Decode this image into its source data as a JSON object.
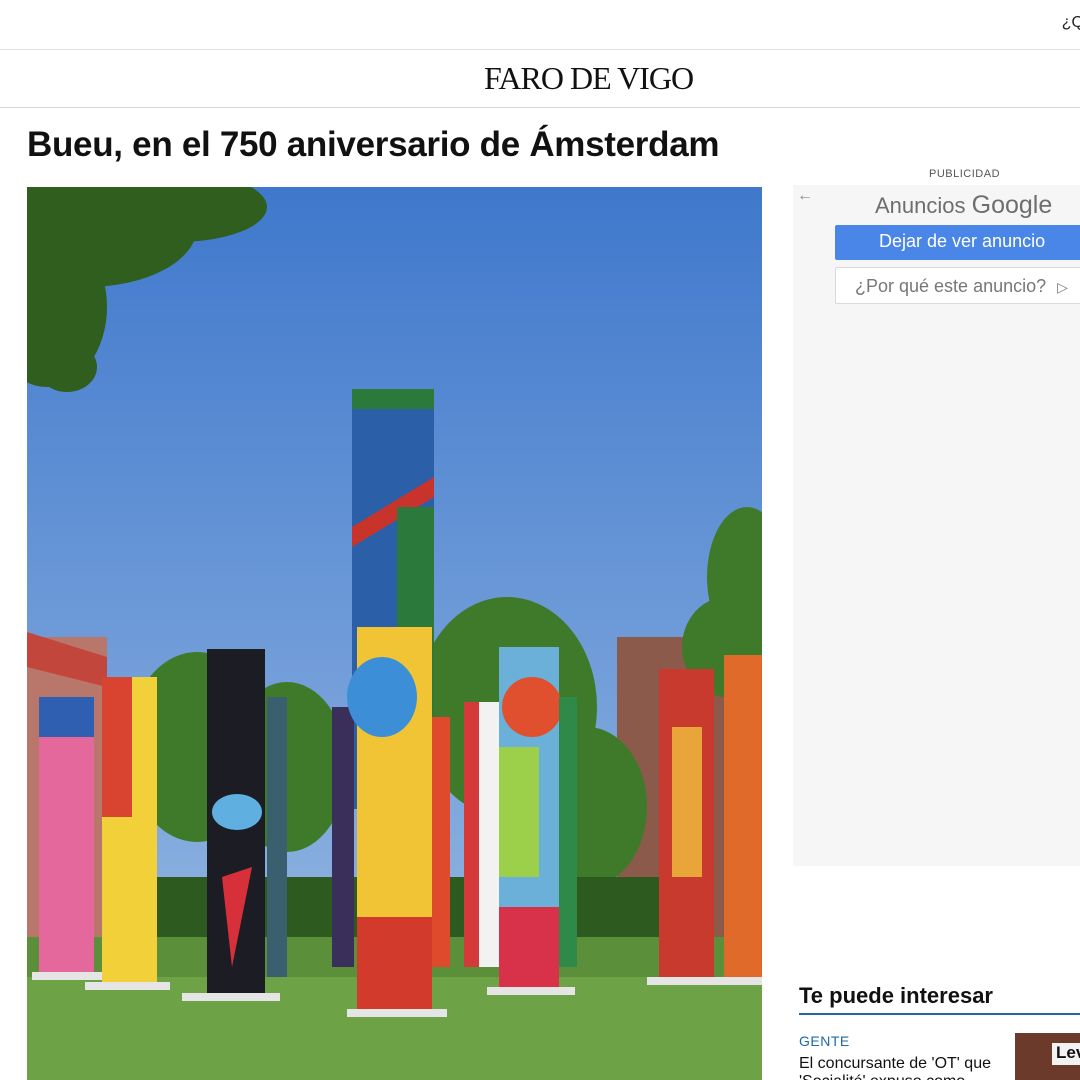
{
  "topbar": {
    "link_text": "¿Q"
  },
  "masthead": {
    "logo_text": "FARO DE VIGO"
  },
  "article": {
    "headline": "Bueu, en el 750 aniversario de Ámsterdam"
  },
  "ad": {
    "label": "PUBLICIDAD",
    "brand_prefix": "Anuncios",
    "brand_name": "Google",
    "stop_button": "Dejar de ver anuncio",
    "why_button": "¿Por qué este anuncio?",
    "back_icon": "arrow-left-icon",
    "why_icon": "adchoices-play-icon"
  },
  "related": {
    "heading": "Te puede interesar",
    "cards": [
      {
        "section": "GENTE",
        "title": "El concursante de 'OT' que 'Socialité' expuso como",
        "thumb_text": "Lev"
      }
    ]
  },
  "colors": {
    "accent_blue": "#1f6aa5",
    "ad_button_blue": "#4a86e8",
    "ad_panel_bg": "#f6f6f6"
  }
}
